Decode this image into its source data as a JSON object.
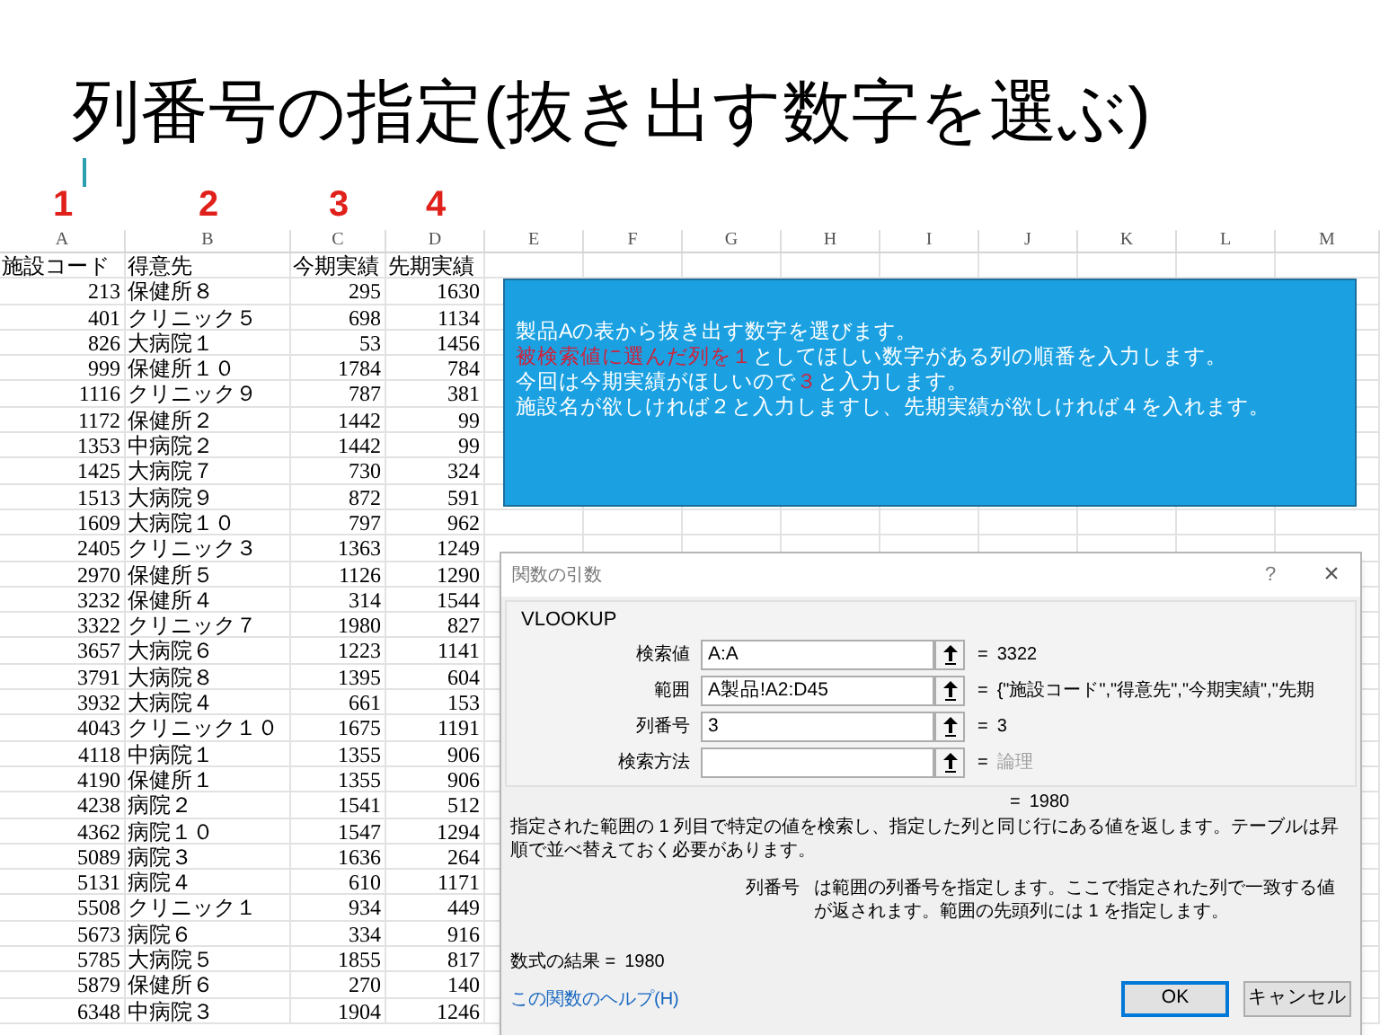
{
  "title": "列番号の指定(抜き出す数字を選ぶ)",
  "column_markers": [
    "1",
    "2",
    "3",
    "4"
  ],
  "column_letters": [
    "A",
    "B",
    "C",
    "D",
    "E",
    "F",
    "G",
    "H",
    "I",
    "J",
    "K",
    "L",
    "M"
  ],
  "table_header": [
    "施設コード",
    "得意先",
    "今期実績",
    "先期実績"
  ],
  "rows": [
    [
      "213",
      "保健所８",
      "295",
      "1630"
    ],
    [
      "401",
      "クリニック５",
      "698",
      "1134"
    ],
    [
      "826",
      "大病院１",
      "53",
      "1456"
    ],
    [
      "999",
      "保健所１０",
      "1784",
      "784"
    ],
    [
      "1116",
      "クリニック９",
      "787",
      "381"
    ],
    [
      "1172",
      "保健所２",
      "1442",
      "99"
    ],
    [
      "1353",
      "中病院２",
      "1442",
      "99"
    ],
    [
      "1425",
      "大病院７",
      "730",
      "324"
    ],
    [
      "1513",
      "大病院９",
      "872",
      "591"
    ],
    [
      "1609",
      "大病院１０",
      "797",
      "962"
    ],
    [
      "2405",
      "クリニック３",
      "1363",
      "1249"
    ],
    [
      "2970",
      "保健所５",
      "1126",
      "1290"
    ],
    [
      "3232",
      "保健所４",
      "314",
      "1544"
    ],
    [
      "3322",
      "クリニック７",
      "1980",
      "827"
    ],
    [
      "3657",
      "大病院６",
      "1223",
      "1141"
    ],
    [
      "3791",
      "大病院８",
      "1395",
      "604"
    ],
    [
      "3932",
      "大病院４",
      "661",
      "153"
    ],
    [
      "4043",
      "クリニック１０",
      "1675",
      "1191"
    ],
    [
      "4118",
      "中病院１",
      "1355",
      "906"
    ],
    [
      "4190",
      "保健所１",
      "1355",
      "906"
    ],
    [
      "4238",
      "病院２",
      "1541",
      "512"
    ],
    [
      "4362",
      "病院１０",
      "1547",
      "1294"
    ],
    [
      "5089",
      "病院３",
      "1636",
      "264"
    ],
    [
      "5131",
      "病院４",
      "610",
      "1171"
    ],
    [
      "5508",
      "クリニック１",
      "934",
      "449"
    ],
    [
      "5673",
      "病院６",
      "334",
      "916"
    ],
    [
      "5785",
      "大病院５",
      "1855",
      "817"
    ],
    [
      "5879",
      "保健所６",
      "270",
      "140"
    ],
    [
      "6348",
      "中病院３",
      "1904",
      "1246"
    ]
  ],
  "note_box": {
    "lines": [
      [
        {
          "text": "製品Aの表から抜き出す数字を選びます。",
          "highlight": false
        }
      ],
      [
        {
          "text": "被検索値に選んだ列を１",
          "highlight": true
        },
        {
          "text": "としてほしい数字がある列の順番を入力します。",
          "highlight": false
        }
      ],
      [
        {
          "text": "今回は今期実績がほしいので",
          "highlight": false
        },
        {
          "text": "３",
          "highlight": true
        },
        {
          "text": "と入力します。",
          "highlight": false
        }
      ],
      [
        {
          "text": "施設名が欲しければ２と入力しますし、先期実績が欲しければ４を入れます。",
          "highlight": false
        }
      ]
    ]
  },
  "dialog": {
    "title": "関数の引数",
    "help": "?",
    "close": "×",
    "function_name": "VLOOKUP",
    "arguments": [
      {
        "label": "検索値",
        "value": "A:A",
        "equals": "=",
        "result": "3322",
        "disabled": false
      },
      {
        "label": "範囲",
        "value": "A製品!A2:D45",
        "equals": "=",
        "result": "{\"施設コード\",\"得意先\",\"今期実績\",\"先期",
        "disabled": false
      },
      {
        "label": "列番号",
        "value": "3",
        "equals": "=",
        "result": "3",
        "disabled": false
      },
      {
        "label": "検索方法",
        "equals": "=",
        "result": "論理",
        "disabled": true
      }
    ],
    "function_result_equals": "=",
    "function_result": "1980",
    "description": "指定された範囲の 1 列目で特定の値を検索し、指定した列と同じ行にある値を返します。テーブルは昇順で並べ替えておく必要があります。",
    "argument_help": {
      "label": "列番号",
      "text": "は範囲の列番号を指定します。ここで指定された列で一致する値が返されます。範囲の先頭列には 1 を指定します。"
    },
    "formula_result_label": "数式の結果 =",
    "formula_result": "1980",
    "help_link": "この関数のヘルプ(H)",
    "buttons": [
      {
        "label": "OK",
        "default": true
      },
      {
        "label": "キャンセル",
        "default": false
      }
    ]
  }
}
